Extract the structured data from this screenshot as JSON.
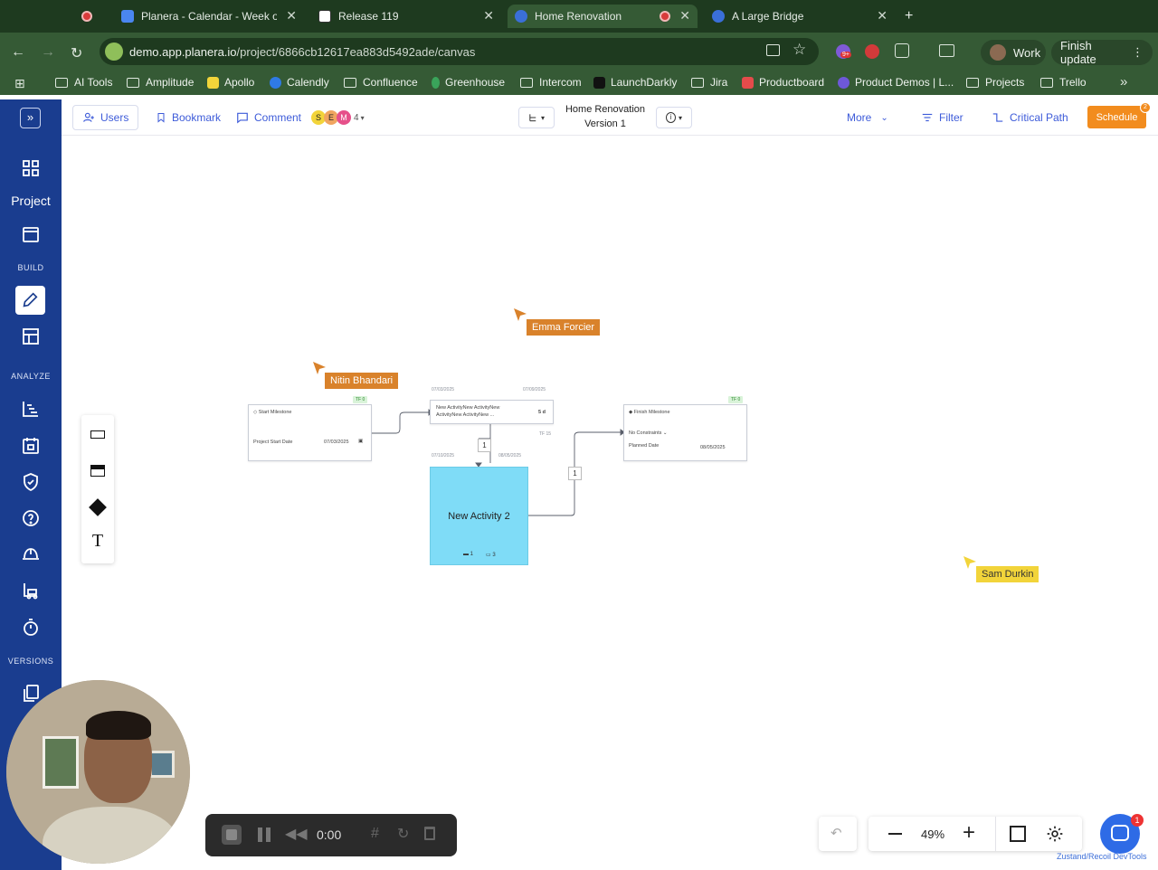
{
  "browser": {
    "tabs": [
      {
        "title": ""
      },
      {
        "title": "Planera - Calendar - Week of"
      },
      {
        "title": "Release 119"
      },
      {
        "title": "Home Renovation"
      },
      {
        "title": "A Large Bridge"
      }
    ],
    "new_tab": "+",
    "url": {
      "host": "demo.app.planera.io",
      "path": "/project/6866cb12617ea883d5492ade/canvas"
    },
    "profile_label": "Work",
    "update_label": "Finish update",
    "extension_badge": "9+",
    "bookmarks": [
      "AI Tools",
      "Amplitude",
      "Apollo",
      "Calendly",
      "Confluence",
      "Greenhouse",
      "Intercom",
      "LaunchDarkly",
      "Jira",
      "Productboard",
      "Product Demos | L...",
      "Projects",
      "Trello"
    ]
  },
  "header": {
    "users": "Users",
    "bookmark": "Bookmark",
    "comment": "Comment",
    "avatars": [
      "S",
      "E",
      "M"
    ],
    "avatar_count": "4",
    "project_title": "Home Renovation",
    "version": "Version 1",
    "more": "More",
    "filter": "Filter",
    "critical_path": "Critical Path",
    "schedule": "Schedule",
    "schedule_badge": "2"
  },
  "sidebar": {
    "project_label": "Project",
    "build": "BUILD",
    "analyze": "ANALYZE",
    "versions": "VERSIONS"
  },
  "canvas": {
    "cursors": [
      {
        "name": "Emma Forcier",
        "color": "#d9822b"
      },
      {
        "name": "Nitin Bhandari",
        "color": "#d9822b"
      },
      {
        "name": "Sam Durkin",
        "color": "#f2d43a"
      }
    ],
    "start_node": {
      "title": "Start Milestone",
      "field": "Project Start Date",
      "date": "07/03/2025",
      "tf": "TF 0"
    },
    "activity1": {
      "line1": "New ActivityNew ActivityNew",
      "line2": "ActivityNew ActivityNew ...",
      "duration": "5 d",
      "start": "07/03/2025",
      "end": "07/09/2025",
      "tf": "TF 15"
    },
    "activity2": {
      "title": "New Activity 2",
      "start": "07/10/2025",
      "end": "08/05/2025",
      "count1": "1",
      "count2": "3"
    },
    "finish_node": {
      "title": "Finish Milestone",
      "constraint": "No Constraints",
      "planned_label": "Planned Date",
      "planned_date": "08/05/2025",
      "tf": "TF 0"
    },
    "link_label_1": "1",
    "link_label_2": "1"
  },
  "recording": {
    "time": "0:00"
  },
  "zoom": {
    "level": "49%"
  },
  "chat_badge": "1",
  "devtools_label": "Zustand/Recoil DevTools"
}
